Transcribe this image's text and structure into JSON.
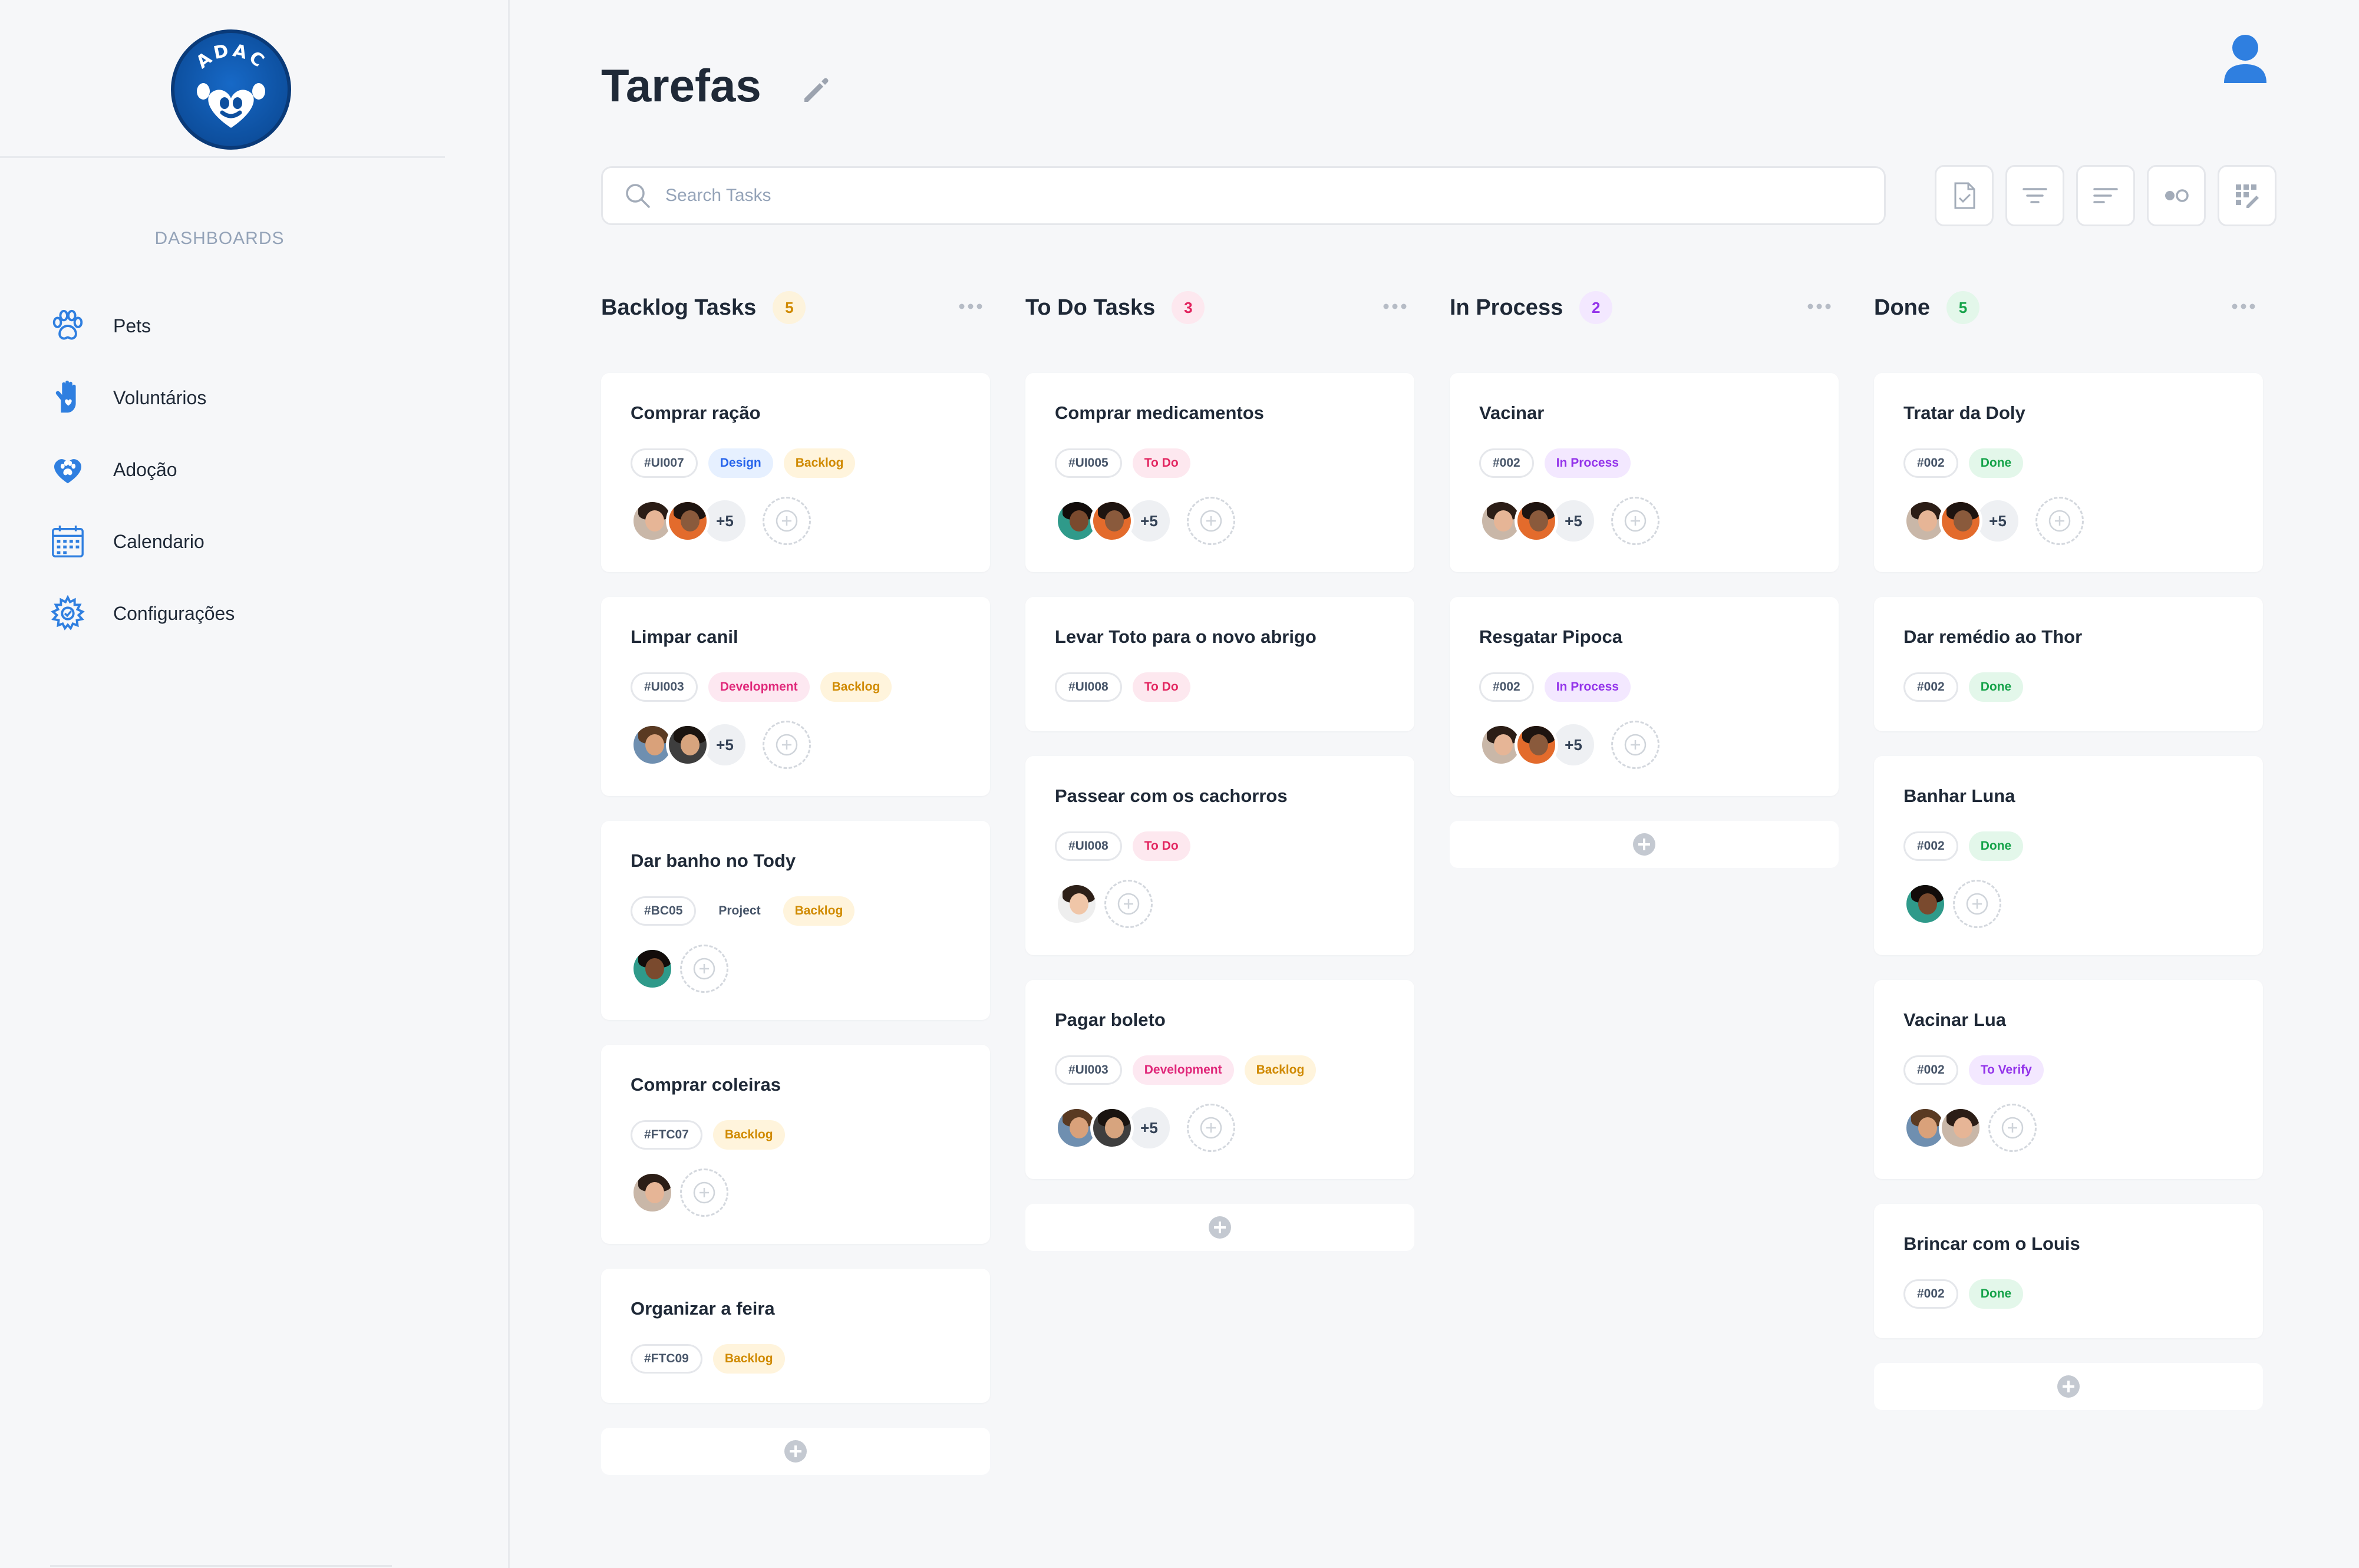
{
  "app": {
    "logo_text": "ADAC",
    "page_title": "Tarefas"
  },
  "sidebar": {
    "heading": "DASHBOARDS",
    "items": [
      {
        "label": "Pets",
        "icon": "paw-icon"
      },
      {
        "label": "Voluntários",
        "icon": "hand-heart-icon"
      },
      {
        "label": "Adoção",
        "icon": "heart-paw-icon"
      },
      {
        "label": "Calendario",
        "icon": "calendar-icon"
      },
      {
        "label": "Configurações",
        "icon": "gear-icon"
      }
    ]
  },
  "search": {
    "placeholder": "Search Tasks",
    "value": ""
  },
  "toolbar": {
    "buttons": [
      "task-check-icon",
      "filter-icon",
      "sort-icon",
      "toggle-view-icon",
      "grid-edit-icon"
    ]
  },
  "colors": {
    "accent": "#2f7fe0",
    "tag_design_bg": "#e6f0ff",
    "tag_design_fg": "#2563eb",
    "tag_backlog_bg": "#fff4dc",
    "tag_backlog_fg": "#d08a00",
    "tag_dev_bg": "#fde8f1",
    "tag_dev_fg": "#e0287a",
    "tag_todo_bg": "#fde8ef",
    "tag_todo_fg": "#e2245f",
    "tag_inprocess_bg": "#f3e8ff",
    "tag_inprocess_fg": "#9333ea",
    "tag_done_bg": "#e3f7ea",
    "tag_done_fg": "#16a34a",
    "tag_verify_bg": "#f3e8ff",
    "tag_verify_fg": "#9333ea",
    "tag_project_bg": "#ffffff",
    "tag_project_fg": "#475569"
  },
  "columns": [
    {
      "title": "Backlog Tasks",
      "count": "5",
      "count_bg": "#fdf3dc",
      "count_fg": "#d08a00",
      "cards": [
        {
          "title": "Comprar ração",
          "tags": [
            {
              "text": "#UI007",
              "kind": "id"
            },
            {
              "text": "Design",
              "kind": "design"
            },
            {
              "text": "Backlog",
              "kind": "backlog"
            }
          ],
          "avatars": [
            "man-a",
            "woman-b"
          ],
          "more": "+5"
        },
        {
          "title": "Limpar canil",
          "tags": [
            {
              "text": "#UI003",
              "kind": "id"
            },
            {
              "text": "Development",
              "kind": "dev"
            },
            {
              "text": "Backlog",
              "kind": "backlog"
            }
          ],
          "avatars": [
            "woman-c",
            "man-d"
          ],
          "more": "+5"
        },
        {
          "title": "Dar banho no Tody",
          "tags": [
            {
              "text": "#BC05",
              "kind": "id"
            },
            {
              "text": "Project",
              "kind": "project"
            },
            {
              "text": "Backlog",
              "kind": "backlog"
            }
          ],
          "avatars": [
            "woman-e"
          ],
          "more": ""
        },
        {
          "title": "Comprar coleiras",
          "tags": [
            {
              "text": "#FTC07",
              "kind": "id"
            },
            {
              "text": "Backlog",
              "kind": "backlog"
            }
          ],
          "avatars": [
            "man-a"
          ],
          "more": ""
        },
        {
          "title": "Organizar a feira",
          "tags": [
            {
              "text": "#FTC09",
              "kind": "id"
            },
            {
              "text": "Backlog",
              "kind": "backlog"
            }
          ],
          "avatars": [],
          "more": ""
        }
      ]
    },
    {
      "title": "To Do Tasks",
      "count": "3",
      "count_bg": "#fde8ef",
      "count_fg": "#e2245f",
      "cards": [
        {
          "title": "Comprar medicamentos",
          "tags": [
            {
              "text": "#UI005",
              "kind": "id"
            },
            {
              "text": "To Do",
              "kind": "todo"
            }
          ],
          "avatars": [
            "woman-e",
            "woman-b"
          ],
          "more": "+5"
        },
        {
          "title": "Levar Toto para o novo abrigo",
          "tags": [
            {
              "text": "#UI008",
              "kind": "id"
            },
            {
              "text": "To Do",
              "kind": "todo"
            }
          ],
          "avatars": [],
          "more": ""
        },
        {
          "title": "Passear com os cachorros",
          "tags": [
            {
              "text": "#UI008",
              "kind": "id"
            },
            {
              "text": "To Do",
              "kind": "todo"
            }
          ],
          "avatars": [
            "woman-f"
          ],
          "more": ""
        },
        {
          "title": "Pagar boleto",
          "tags": [
            {
              "text": "#UI003",
              "kind": "id"
            },
            {
              "text": "Development",
              "kind": "dev"
            },
            {
              "text": "Backlog",
              "kind": "backlog"
            }
          ],
          "avatars": [
            "woman-c",
            "man-d"
          ],
          "more": "+5"
        }
      ]
    },
    {
      "title": "In Process",
      "count": "2",
      "count_bg": "#f3e8ff",
      "count_fg": "#9333ea",
      "cards": [
        {
          "title": "Vacinar",
          "tags": [
            {
              "text": "#002",
              "kind": "id"
            },
            {
              "text": "In Process",
              "kind": "inprocess"
            }
          ],
          "avatars": [
            "man-a",
            "woman-b"
          ],
          "more": "+5"
        },
        {
          "title": "Resgatar Pipoca",
          "tags": [
            {
              "text": "#002",
              "kind": "id"
            },
            {
              "text": "In Process",
              "kind": "inprocess"
            }
          ],
          "avatars": [
            "man-a",
            "woman-b"
          ],
          "more": "+5"
        }
      ]
    },
    {
      "title": "Done",
      "count": "5",
      "count_bg": "#e3f7ea",
      "count_fg": "#16a34a",
      "cards": [
        {
          "title": "Tratar da Doly",
          "tags": [
            {
              "text": "#002",
              "kind": "id"
            },
            {
              "text": "Done",
              "kind": "done"
            }
          ],
          "avatars": [
            "man-a",
            "woman-b"
          ],
          "more": "+5"
        },
        {
          "title": "Dar remédio ao Thor",
          "tags": [
            {
              "text": "#002",
              "kind": "id"
            },
            {
              "text": "Done",
              "kind": "done"
            }
          ],
          "avatars": [],
          "more": ""
        },
        {
          "title": "Banhar Luna",
          "tags": [
            {
              "text": "#002",
              "kind": "id"
            },
            {
              "text": "Done",
              "kind": "done"
            }
          ],
          "avatars": [
            "woman-e"
          ],
          "more": ""
        },
        {
          "title": "Vacinar Lua",
          "tags": [
            {
              "text": "#002",
              "kind": "id"
            },
            {
              "text": "To Verify",
              "kind": "verify"
            }
          ],
          "avatars": [
            "woman-c",
            "man-a"
          ],
          "more": ""
        },
        {
          "title": "Brincar com  o Louis",
          "tags": [
            {
              "text": "#002",
              "kind": "id"
            },
            {
              "text": "Done",
              "kind": "done"
            }
          ],
          "avatars": [],
          "more": ""
        }
      ]
    }
  ]
}
